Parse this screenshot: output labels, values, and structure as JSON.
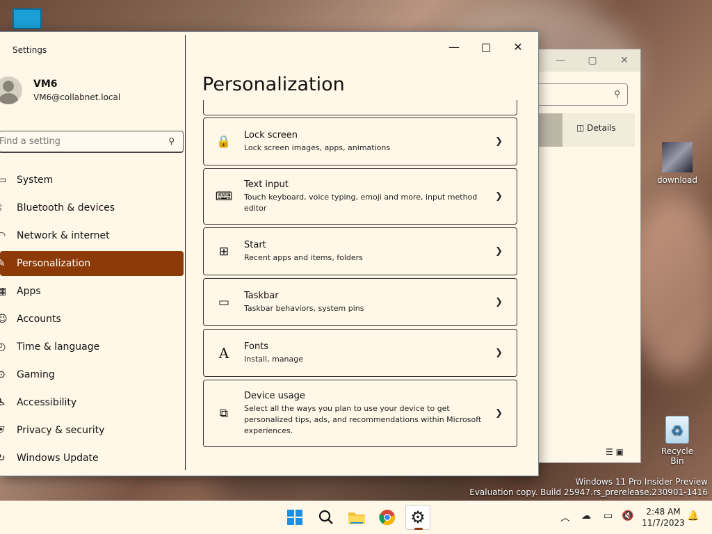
{
  "desktop": {
    "icons": [
      {
        "label": "download"
      },
      {
        "label": "Recycle Bin"
      }
    ],
    "watermark": {
      "line1": "Windows 11 Pro Insider Preview",
      "line2": "Evaluation copy. Build 25947.rs_prerelease.230901-1416"
    }
  },
  "explorer": {
    "details_label": "Details"
  },
  "settings": {
    "window_title": "Settings",
    "profile": {
      "name": "VM6",
      "email": "VM6@collabnet.local"
    },
    "search": {
      "placeholder": "Find a setting"
    },
    "nav": [
      {
        "label": "System",
        "icon": "▭"
      },
      {
        "label": "Bluetooth & devices",
        "icon": "ᛒ"
      },
      {
        "label": "Network & internet",
        "icon": "◠"
      },
      {
        "label": "Personalization",
        "icon": "✎"
      },
      {
        "label": "Apps",
        "icon": "▦"
      },
      {
        "label": "Accounts",
        "icon": "☺"
      },
      {
        "label": "Time & language",
        "icon": "◴"
      },
      {
        "label": "Gaming",
        "icon": "⊙"
      },
      {
        "label": "Accessibility",
        "icon": "♿"
      },
      {
        "label": "Privacy & security",
        "icon": "⛨"
      },
      {
        "label": "Windows Update",
        "icon": "↻"
      }
    ],
    "page_title": "Personalization",
    "cards": [
      {
        "title": "Lock screen",
        "subtitle": "Lock screen images, apps, animations",
        "icon": "🔒"
      },
      {
        "title": "Text input",
        "subtitle": "Touch keyboard, voice typing, emoji and more, input method editor",
        "icon": "⌨"
      },
      {
        "title": "Start",
        "subtitle": "Recent apps and items, folders",
        "icon": "⊞"
      },
      {
        "title": "Taskbar",
        "subtitle": "Taskbar behaviors, system pins",
        "icon": "▭"
      },
      {
        "title": "Fonts",
        "subtitle": "Install, manage",
        "icon": "A"
      },
      {
        "title": "Device usage",
        "subtitle": "Select all the ways you plan to use your device to get personalized tips, ads, and recommendations within Microsoft experiences.",
        "icon": "⧉"
      }
    ]
  },
  "taskbar": {
    "time": "2:48 AM",
    "date": "11/7/2023"
  },
  "colors": {
    "accent": "#8c3b08",
    "window_bg": "#fff8e8"
  }
}
